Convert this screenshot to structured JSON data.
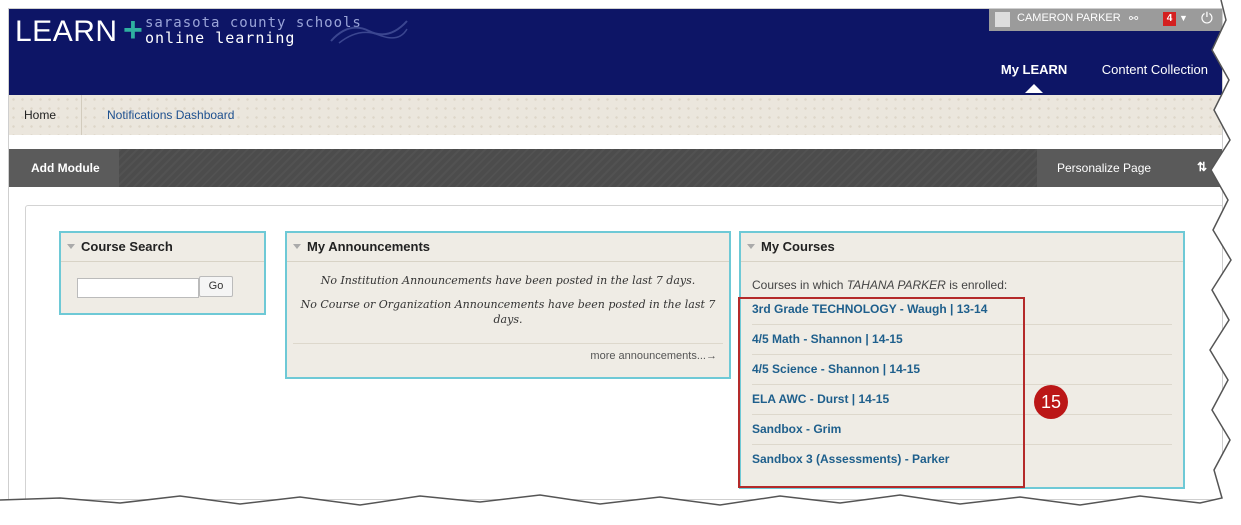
{
  "header": {
    "logo": "LEARN",
    "logo_plus": "+",
    "logo_sub1": "sarasota county schools",
    "logo_sub2": "online learning",
    "user_name": "CAMERON PARKER",
    "notification_count": "4",
    "tabs": [
      {
        "label": "My LEARN",
        "active": true
      },
      {
        "label": "Content Collection",
        "active": false
      }
    ]
  },
  "subnav": {
    "home": "Home",
    "notifications": "Notifications Dashboard"
  },
  "toolbar": {
    "add_module": "Add Module",
    "personalize": "Personalize Page",
    "sort_icon": "⇅"
  },
  "course_search": {
    "title": "Course Search",
    "input_value": "",
    "button": "Go"
  },
  "announcements": {
    "title": "My Announcements",
    "line1": "No Institution Announcements have been posted in the last 7 days.",
    "line2": "No Course or Organization Announcements have been posted in the last 7 days.",
    "more": "more announcements...→"
  },
  "courses": {
    "title": "My Courses",
    "intro_prefix": "Courses in which",
    "intro_name": "TAHANA PARKER",
    "intro_suffix": "is enrolled:",
    "items": [
      "3rd Grade TECHNOLOGY - Waugh | 13-14",
      "4/5 Math - Shannon | 14-15",
      "4/5 Science - Shannon | 14-15",
      "ELA AWC - Durst | 14-15",
      "Sandbox - Grim",
      "Sandbox 3 (Assessments) - Parker"
    ]
  },
  "annotation": {
    "step_number": "15",
    "color": "#bb1717"
  },
  "colors": {
    "header_bg": "#0d1566",
    "module_border": "#6ec9d6",
    "link": "#1e5f8c"
  }
}
